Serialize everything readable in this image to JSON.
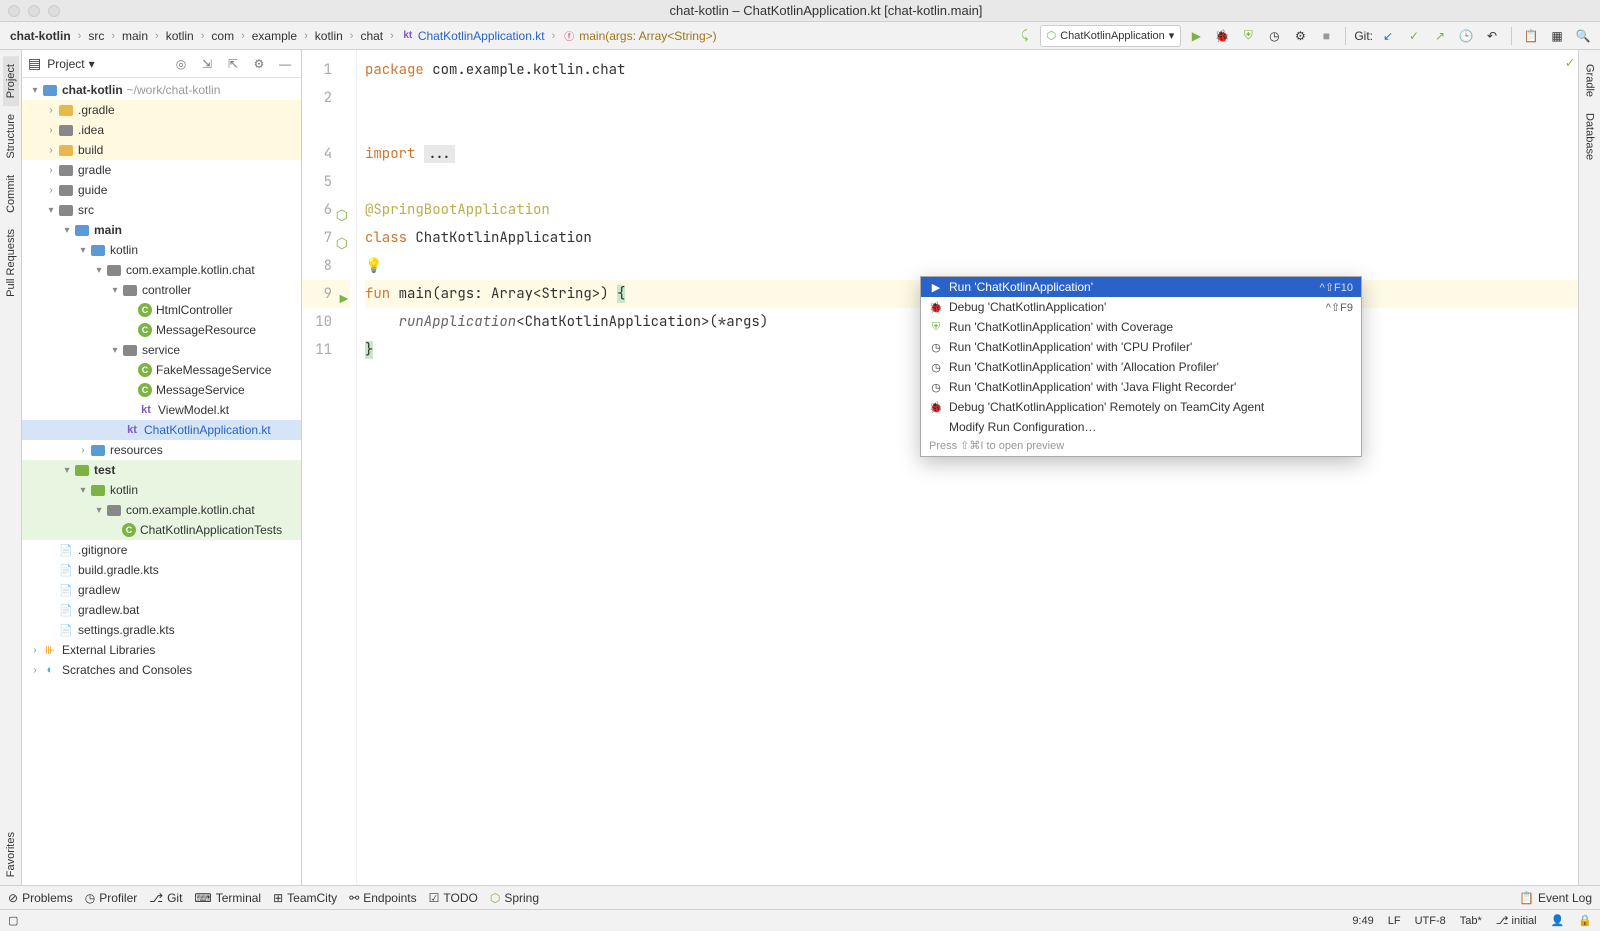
{
  "titlebar": "chat-kotlin – ChatKotlinApplication.kt [chat-kotlin.main]",
  "breadcrumbs": [
    "chat-kotlin",
    "src",
    "main",
    "kotlin",
    "com",
    "example",
    "kotlin",
    "chat",
    "ChatKotlinApplication.kt",
    "main(args: Array<String>)"
  ],
  "run_config": {
    "label": "ChatKotlinApplication"
  },
  "git_label": "Git:",
  "project": {
    "title": "Project",
    "root": "chat-kotlin",
    "root_path": "~/work/chat-kotlin",
    "items": [
      ".gradle",
      ".idea",
      "build",
      "gradle",
      "guide",
      "src",
      "main",
      "kotlin",
      "com.example.kotlin.chat",
      "controller",
      "HtmlController",
      "MessageResource",
      "service",
      "FakeMessageService",
      "MessageService",
      "ViewModel.kt",
      "ChatKotlinApplication.kt",
      "resources",
      "test",
      "kotlin",
      "com.example.kotlin.chat",
      "ChatKotlinApplicationTests",
      ".gitignore",
      "build.gradle.kts",
      "gradlew",
      "gradlew.bat",
      "settings.gradle.kts",
      "External Libraries",
      "Scratches and Consoles"
    ]
  },
  "left_tabs": [
    "Project",
    "Structure",
    "Commit",
    "Pull Requests",
    "Favorites"
  ],
  "right_tabs": [
    "Gradle",
    "Database"
  ],
  "code": {
    "lines": [
      "package com.example.kotlin.chat",
      "",
      "",
      "import ...",
      "",
      "@SpringBootApplication",
      "class ChatKotlinApplication",
      "",
      "fun main(args: Array<String>) {",
      "    runApplication<ChatKotlinApplication>(*args)",
      "}"
    ],
    "line_nums": [
      "1",
      "2",
      "",
      "4",
      "5",
      "6",
      "7",
      "8",
      "9",
      "10",
      "11"
    ]
  },
  "popup": {
    "items": [
      {
        "label": "Run 'ChatKotlinApplication'",
        "sc": "^⇧F10"
      },
      {
        "label": "Debug 'ChatKotlinApplication'",
        "sc": "^⇧F9"
      },
      {
        "label": "Run 'ChatKotlinApplication' with Coverage",
        "sc": ""
      },
      {
        "label": "Run 'ChatKotlinApplication' with 'CPU Profiler'",
        "sc": ""
      },
      {
        "label": "Run 'ChatKotlinApplication' with 'Allocation Profiler'",
        "sc": ""
      },
      {
        "label": "Run 'ChatKotlinApplication' with 'Java Flight Recorder'",
        "sc": ""
      },
      {
        "label": "Debug 'ChatKotlinApplication' Remotely on TeamCity Agent",
        "sc": ""
      },
      {
        "label": "Modify Run Configuration…",
        "sc": ""
      }
    ],
    "footer": "Press ⇧⌘I to open preview"
  },
  "bottom": {
    "items": [
      "Problems",
      "Profiler",
      "Git",
      "Terminal",
      "TeamCity",
      "Endpoints",
      "TODO",
      "Spring"
    ],
    "right": "Event Log"
  },
  "status": {
    "caret": "9:49",
    "lf": "LF",
    "enc": "UTF-8",
    "tab": "Tab*",
    "branch": "initial"
  }
}
